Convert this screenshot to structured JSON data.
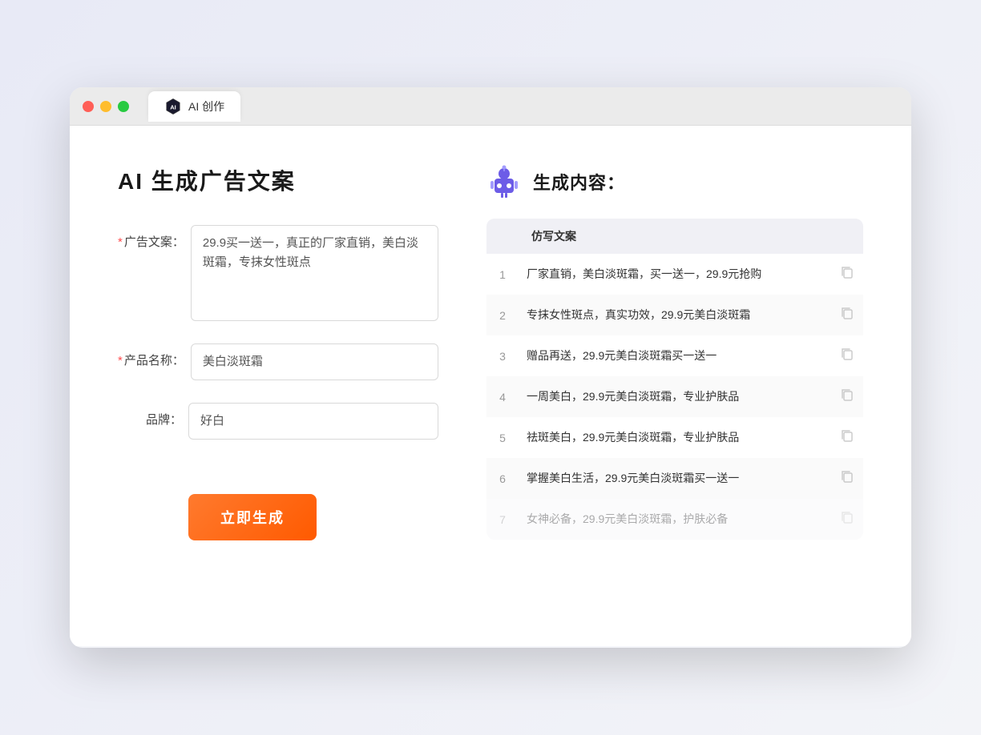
{
  "browser": {
    "tab_label": "AI 创作"
  },
  "page": {
    "title": "AI 生成广告文案",
    "result_section_label": "生成内容：",
    "ad_copy_label": "广告文案：",
    "product_name_label": "产品名称：",
    "brand_label": "品牌：",
    "ad_copy_value": "29.9买一送一，真正的厂家直销，美白淡斑霜，专抹女性斑点",
    "product_name_value": "美白淡斑霜",
    "brand_value": "好白",
    "generate_button_label": "立即生成",
    "table_header": "仿写文案",
    "results": [
      {
        "num": "1",
        "text": "厂家直销，美白淡斑霜，买一送一，29.9元抢购",
        "dimmed": false
      },
      {
        "num": "2",
        "text": "专抹女性斑点，真实功效，29.9元美白淡斑霜",
        "dimmed": false
      },
      {
        "num": "3",
        "text": "赠品再送，29.9元美白淡斑霜买一送一",
        "dimmed": false
      },
      {
        "num": "4",
        "text": "一周美白，29.9元美白淡斑霜，专业护肤品",
        "dimmed": false
      },
      {
        "num": "5",
        "text": "祛斑美白，29.9元美白淡斑霜，专业护肤品",
        "dimmed": false
      },
      {
        "num": "6",
        "text": "掌握美白生活，29.9元美白淡斑霜买一送一",
        "dimmed": false
      },
      {
        "num": "7",
        "text": "女神必备，29.9元美白淡斑霜，护肤必备",
        "dimmed": true
      }
    ]
  }
}
